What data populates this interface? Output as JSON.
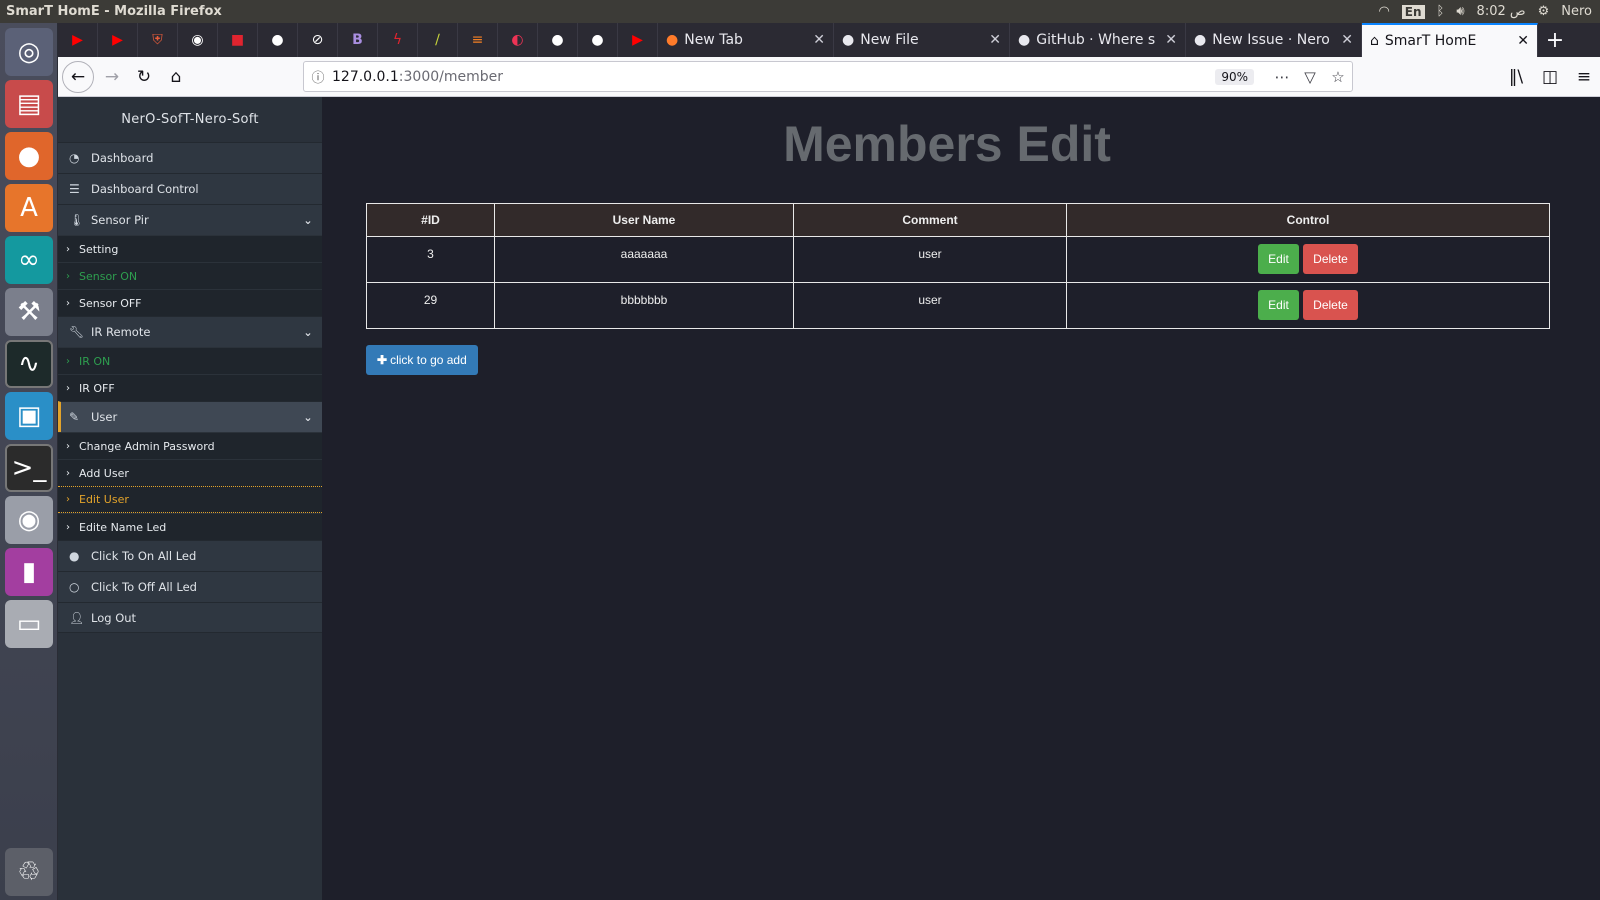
{
  "os": {
    "window_title": "SmarT HomE - Mozilla Firefox",
    "keyboard_lang": "En",
    "clock": "8:02 ص",
    "user": "Nero"
  },
  "browser": {
    "tabs": [
      {
        "label": "New Tab"
      },
      {
        "label": "New File"
      },
      {
        "label": "GitHub · Where s"
      },
      {
        "label": "New Issue · Nero"
      },
      {
        "label": "SmarT HomE"
      }
    ],
    "url_host": "127.0.0.1",
    "url_path": ":3000/member",
    "zoom": "90%"
  },
  "sidebar": {
    "brand": "NerO-SofT-Nero-Soft",
    "items": [
      {
        "label": "Dashboard"
      },
      {
        "label": "Dashboard Control"
      },
      {
        "label": "Sensor Pir"
      },
      {
        "label": "Setting"
      },
      {
        "label": "Sensor ON"
      },
      {
        "label": "Sensor OFF"
      },
      {
        "label": "IR Remote"
      },
      {
        "label": "IR ON"
      },
      {
        "label": "IR OFF"
      },
      {
        "label": "User"
      },
      {
        "label": "Change Admin Password"
      },
      {
        "label": "Add User"
      },
      {
        "label": "Edit User"
      },
      {
        "label": "Edite Name Led"
      },
      {
        "label": "Click To On All Led"
      },
      {
        "label": "Click To Off All Led"
      },
      {
        "label": "Log Out"
      }
    ]
  },
  "main": {
    "title": "Members Edit",
    "table": {
      "headers": [
        "#ID",
        "User Name",
        "Comment",
        "Control"
      ],
      "rows": [
        {
          "id": "3",
          "username": "aaaaaaa",
          "comment": "user",
          "edit": "Edit",
          "delete": "Delete"
        },
        {
          "id": "29",
          "username": "bbbbbbb",
          "comment": "user",
          "edit": "Edit",
          "delete": "Delete"
        }
      ]
    },
    "add_button": "click to go add"
  }
}
